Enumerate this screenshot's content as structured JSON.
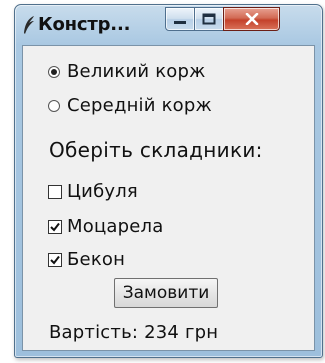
{
  "window": {
    "title": "Констр...",
    "app_icon": "feather-icon",
    "controls": {
      "minimize_icon": "minimize-icon",
      "maximize_icon": "maximize-icon",
      "close_icon": "close-icon",
      "close_color": "#c4412a"
    }
  },
  "crust": {
    "options": [
      {
        "label": "Великий корж",
        "selected": true
      },
      {
        "label": "Середній корж",
        "selected": false
      }
    ]
  },
  "toppings": {
    "heading": "Оберіть складники:",
    "items": [
      {
        "label": "Цибуля",
        "checked": false
      },
      {
        "label": "Моцарела",
        "checked": true
      },
      {
        "label": "Бекон",
        "checked": true
      }
    ]
  },
  "order": {
    "button_label": "Замовити",
    "price_text": "Вартість: 234 грн"
  }
}
